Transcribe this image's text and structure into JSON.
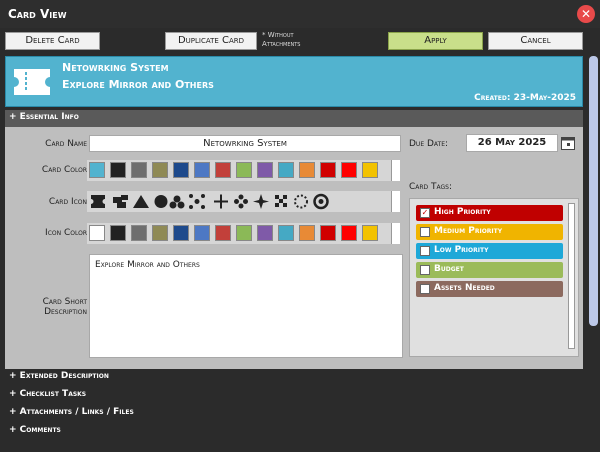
{
  "window": {
    "title": "Card View",
    "close_glyph": "✕"
  },
  "toolbar": {
    "delete_label": "Delete Card",
    "duplicate_label": "Duplicate Card",
    "duplicate_note_line1": "* Without",
    "duplicate_note_line2": "Attachments",
    "apply_label": "Apply",
    "cancel_label": "Cancel"
  },
  "header": {
    "system": "Netowrking System",
    "title": "Explore Mirror and Others",
    "created": "Created: 23-May-2025"
  },
  "sections": {
    "essential": "+ Essential Info",
    "extended": "+ Extended Description",
    "checklist": "+ Checklist Tasks",
    "attachments": "+ Attachments / Links / Files",
    "comments": "+ Comments"
  },
  "form": {
    "card_name_label": "Card Name",
    "card_name_value": "Netowrking System",
    "card_color_label": "Card Color",
    "card_icon_label": "Card Icon",
    "icon_color_label": "Icon Color",
    "short_desc_label_1": "Card Short",
    "short_desc_label_2": "Description",
    "short_desc_value": "Explore Mirror and Others",
    "due_date_label": "Due Date:",
    "due_date_value": "26 May 2025",
    "card_tags_label": "Card Tags:"
  },
  "card_colors": [
    "#52b3cf",
    "#222222",
    "#6e6e6e",
    "#8f8a55",
    "#1e4a8c",
    "#4d78c4",
    "#c2403a",
    "#8bb957",
    "#7f5aa8",
    "#45a9c4",
    "#e88a36",
    "#d00000",
    "#ff0000",
    "#f2c200"
  ],
  "icon_colors": [
    "#ffffff",
    "#222222",
    "#6e6e6e",
    "#8f8a55",
    "#1e4a8c",
    "#4d78c4",
    "#c2403a",
    "#8bb957",
    "#7f5aa8",
    "#45a9c4",
    "#e88a36",
    "#d00000",
    "#ff0000",
    "#f2c200"
  ],
  "icons": [
    "ticket-icon",
    "stacked-boxes-icon",
    "warning-icon",
    "half-circle-icon",
    "hexagon-cluster-icon",
    "network-icon",
    "crosshair-icon",
    "flower-icon",
    "star-burst-icon",
    "checker-icon",
    "dotted-circle-icon",
    "aperture-icon"
  ],
  "tags": [
    {
      "label": "High Priority",
      "color": "#c00000",
      "checked": true
    },
    {
      "label": "Medium Priority",
      "color": "#f0b400",
      "checked": false
    },
    {
      "label": "Low Priority",
      "color": "#1ea8d8",
      "checked": false
    },
    {
      "label": "Budget",
      "color": "#9bbb59",
      "checked": false
    },
    {
      "label": "Assets Needed",
      "color": "#8c6a5f",
      "checked": false
    }
  ]
}
